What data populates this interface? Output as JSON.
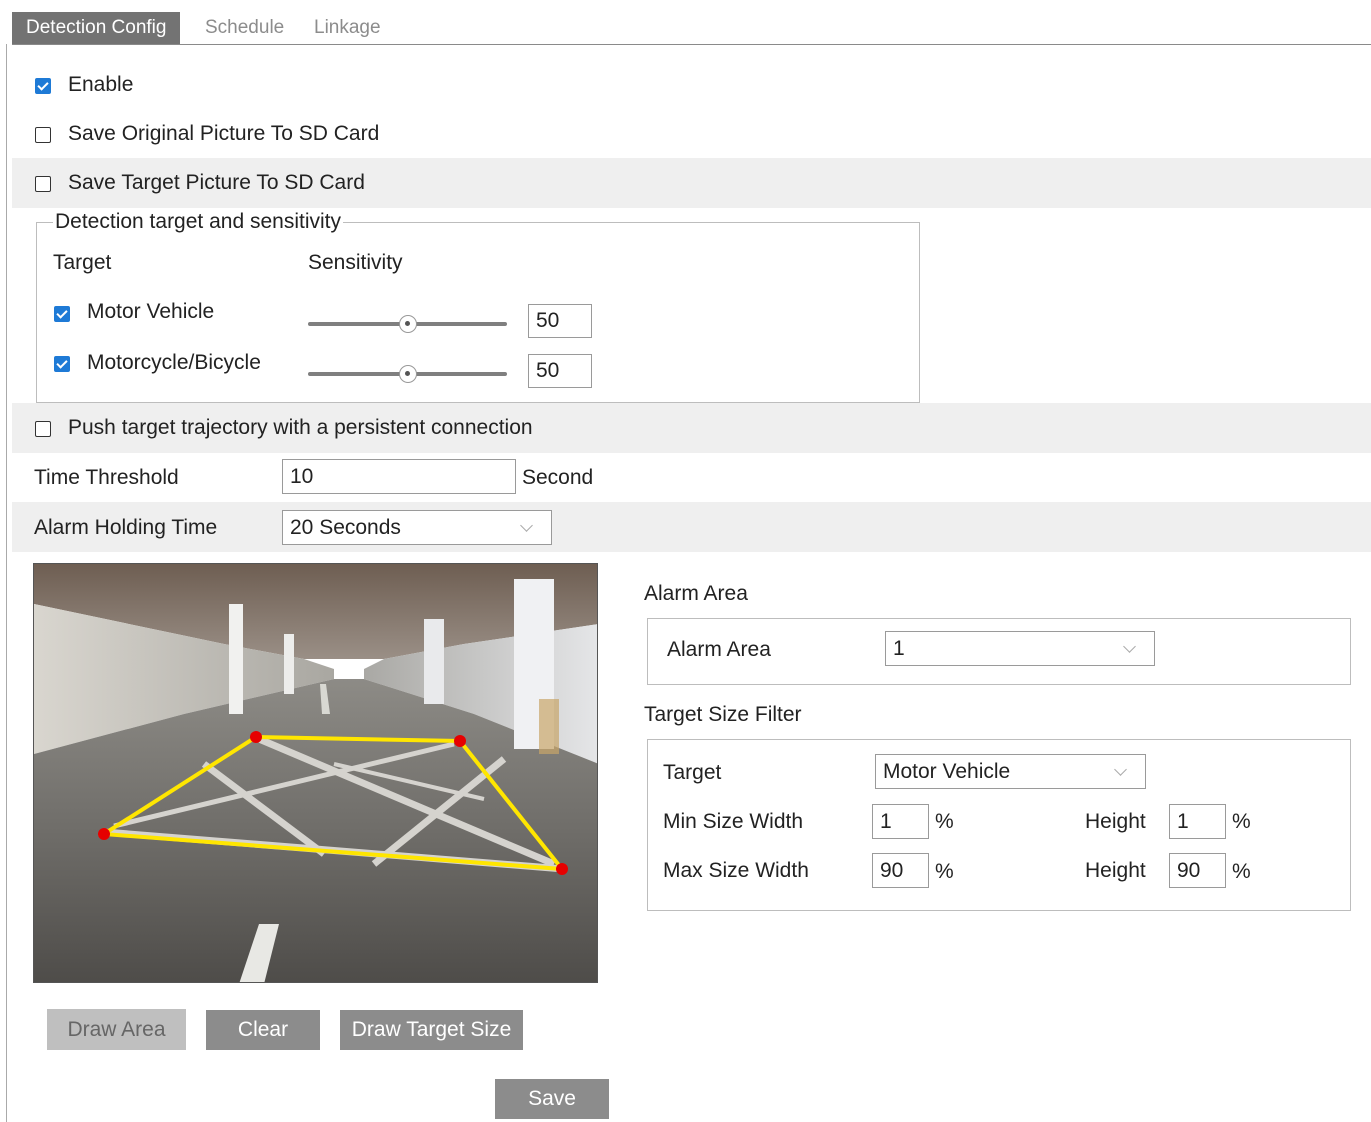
{
  "tabs": [
    {
      "label": "Detection Config",
      "active": true
    },
    {
      "label": "Schedule",
      "active": false
    },
    {
      "label": "Linkage",
      "active": false
    }
  ],
  "options": {
    "enable": {
      "label": "Enable",
      "checked": true
    },
    "save_original": {
      "label": "Save Original Picture To SD Card",
      "checked": false
    },
    "save_target": {
      "label": "Save Target Picture To SD Card",
      "checked": false
    },
    "push_trajectory": {
      "label": "Push target trajectory with a persistent connection",
      "checked": false
    }
  },
  "detection": {
    "legend": "Detection target and sensitivity",
    "target_header": "Target",
    "sensitivity_header": "Sensitivity",
    "rows": [
      {
        "label": "Motor Vehicle",
        "checked": true,
        "value": "50",
        "level": 0.5
      },
      {
        "label": "Motorcycle/Bicycle",
        "checked": true,
        "value": "50",
        "level": 0.5
      }
    ]
  },
  "time_threshold": {
    "label": "Time Threshold",
    "value": "10",
    "unit": "Second"
  },
  "alarm_holding": {
    "label": "Alarm Holding Time",
    "value": "20 Seconds"
  },
  "alarm_area": {
    "section_title": "Alarm Area",
    "field_label": "Alarm Area",
    "value": "1"
  },
  "size_filter": {
    "section_title": "Target Size Filter",
    "target_label": "Target",
    "target_value": "Motor Vehicle",
    "min_width_label": "Min Size Width",
    "min_width": "1",
    "max_width_label": "Max Size Width",
    "max_width": "90",
    "height_label": "Height",
    "min_height": "1",
    "max_height": "90",
    "percent": "%"
  },
  "buttons": {
    "draw_area": "Draw Area",
    "clear": "Clear",
    "draw_target_size": "Draw Target Size",
    "save": "Save"
  },
  "colors": {
    "tab_active": "#737373",
    "checkbox": "#1e7ad6",
    "button": "#8c8c8c",
    "area_line": "#ffe600",
    "area_handle": "#e60000"
  }
}
